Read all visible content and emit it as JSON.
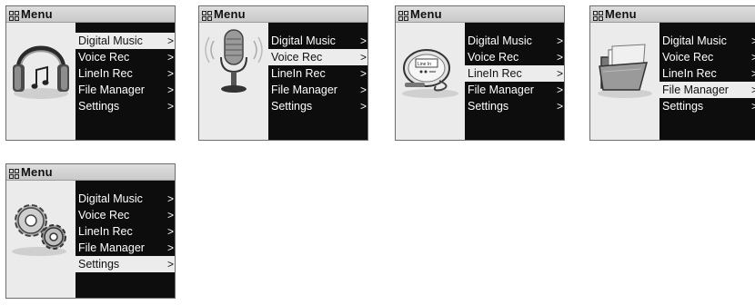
{
  "title": "Menu",
  "items": [
    "Digital Music",
    "Voice Rec",
    "LineIn Rec",
    "File Manager",
    "Settings"
  ],
  "screens": [
    {
      "icon": "headphones-icon",
      "selected": 0
    },
    {
      "icon": "microphone-icon",
      "selected": 1
    },
    {
      "icon": "line-in-device-icon",
      "selected": 2
    },
    {
      "icon": "folder-icon",
      "selected": 3
    },
    {
      "icon": "gear-icon",
      "selected": 4
    }
  ],
  "device_label": "Line In"
}
